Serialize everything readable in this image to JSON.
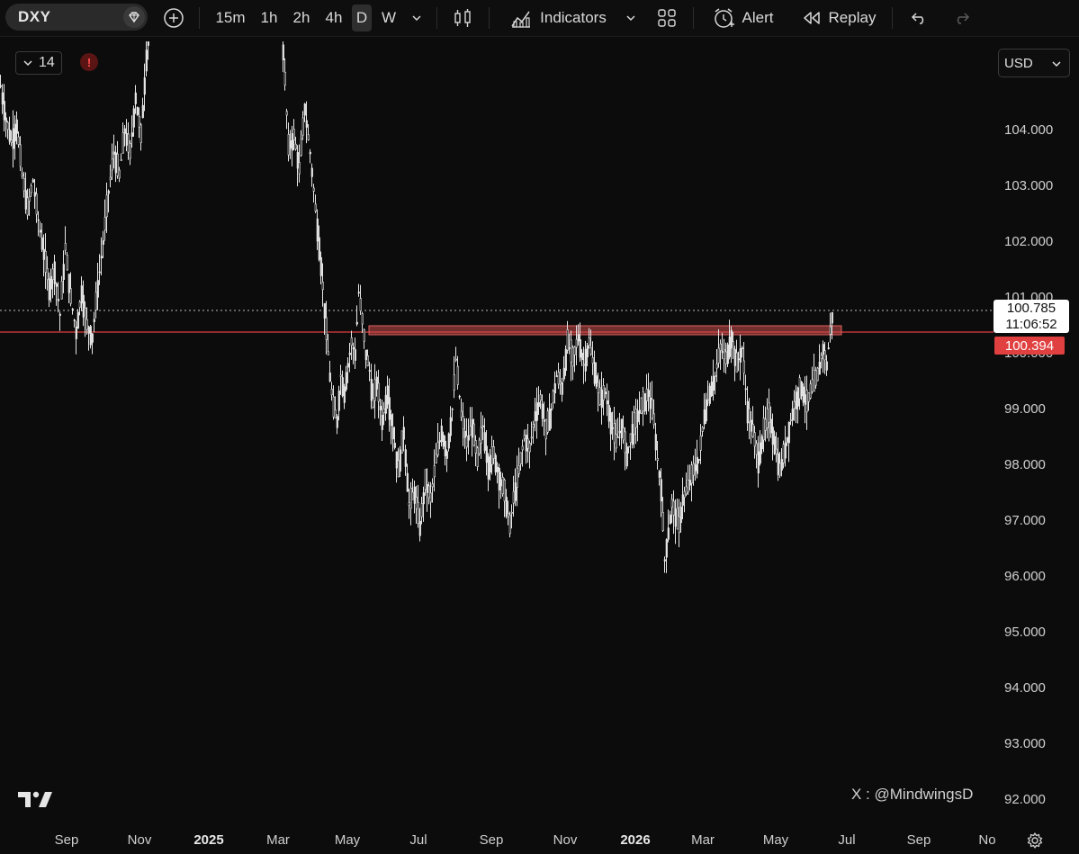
{
  "toolbar": {
    "symbol": "DXY",
    "timeframes": [
      "15m",
      "1h",
      "2h",
      "4h",
      "D",
      "W"
    ],
    "active_timeframe": "D",
    "indicators_label": "Indicators",
    "alert_label": "Alert",
    "replay_label": "Replay"
  },
  "legend": {
    "value": "14"
  },
  "currency": "USD",
  "price_axis": {
    "ticks": [
      "104.000",
      "103.000",
      "102.000",
      "101.000",
      "100.000",
      "99.000",
      "98.000",
      "97.000",
      "96.000",
      "95.000",
      "94.000",
      "93.000",
      "92.000"
    ]
  },
  "time_axis": {
    "ticks": [
      {
        "label": "Sep",
        "bold": false
      },
      {
        "label": "Nov",
        "bold": false
      },
      {
        "label": "2025",
        "bold": true
      },
      {
        "label": "Mar",
        "bold": false
      },
      {
        "label": "May",
        "bold": false
      },
      {
        "label": "Jul",
        "bold": false
      },
      {
        "label": "Sep",
        "bold": false
      },
      {
        "label": "Nov",
        "bold": false
      },
      {
        "label": "2026",
        "bold": true
      },
      {
        "label": "Mar",
        "bold": false
      },
      {
        "label": "May",
        "bold": false
      },
      {
        "label": "Jul",
        "bold": false
      },
      {
        "label": "Sep",
        "bold": false
      },
      {
        "label": "No",
        "bold": false
      }
    ]
  },
  "current_price": {
    "price": "100.785",
    "countdown": "11:06:52"
  },
  "level_price": "100.394",
  "watermark": "X : @MindwingsD",
  "colors": {
    "background": "#0c0c0c",
    "candle": "#e6e6e6",
    "level_line": "#e04040",
    "zone_fill": "#c84a4a"
  },
  "chart_data": {
    "type": "candlestick",
    "ylim": [
      91.5,
      105.0
    ],
    "horizontal_level": 100.394,
    "current_price": 100.785,
    "resistance_zone": [
      100.35,
      100.6
    ],
    "close_path": [
      [
        0,
        104.8
      ],
      [
        6,
        104.2
      ],
      [
        12,
        103.8
      ],
      [
        18,
        104.1
      ],
      [
        24,
        103.2
      ],
      [
        30,
        102.6
      ],
      [
        36,
        103.1
      ],
      [
        42,
        102.4
      ],
      [
        48,
        101.8
      ],
      [
        54,
        101.2
      ],
      [
        60,
        101.5
      ],
      [
        66,
        100.7
      ],
      [
        72,
        101.9
      ],
      [
        78,
        101.0
      ],
      [
        84,
        100.4
      ],
      [
        90,
        101.1
      ],
      [
        96,
        100.5
      ],
      [
        102,
        100.3
      ],
      [
        108,
        101.2
      ],
      [
        114,
        102.0
      ],
      [
        120,
        102.9
      ],
      [
        126,
        103.6
      ],
      [
        132,
        103.2
      ],
      [
        138,
        104.0
      ],
      [
        144,
        103.6
      ],
      [
        150,
        104.6
      ],
      [
        156,
        103.9
      ],
      [
        162,
        105.3
      ],
      [
        168,
        106.2
      ],
      [
        174,
        107.0
      ],
      [
        310,
        106.5
      ],
      [
        316,
        104.9
      ],
      [
        320,
        103.7
      ],
      [
        326,
        103.9
      ],
      [
        332,
        103.3
      ],
      [
        338,
        104.4
      ],
      [
        344,
        103.6
      ],
      [
        350,
        102.6
      ],
      [
        356,
        101.6
      ],
      [
        362,
        100.4
      ],
      [
        366,
        99.6
      ],
      [
        370,
        99.0
      ],
      [
        374,
        98.8
      ],
      [
        378,
        99.6
      ],
      [
        382,
        99.3
      ],
      [
        386,
        99.8
      ],
      [
        390,
        100.2
      ],
      [
        394,
        100.0
      ],
      [
        398,
        101.1
      ],
      [
        402,
        100.6
      ],
      [
        406,
        100.0
      ],
      [
        410,
        99.7
      ],
      [
        414,
        99.1
      ],
      [
        418,
        99.5
      ],
      [
        424,
        98.8
      ],
      [
        430,
        99.3
      ],
      [
        436,
        98.6
      ],
      [
        442,
        97.9
      ],
      [
        448,
        98.6
      ],
      [
        454,
        97.3
      ],
      [
        460,
        97.5
      ],
      [
        466,
        96.9
      ],
      [
        472,
        97.7
      ],
      [
        478,
        97.4
      ],
      [
        484,
        98.1
      ],
      [
        490,
        98.6
      ],
      [
        496,
        98.2
      ],
      [
        502,
        99.0
      ],
      [
        506,
        99.9
      ],
      [
        512,
        98.9
      ],
      [
        518,
        98.4
      ],
      [
        524,
        98.7
      ],
      [
        530,
        98.1
      ],
      [
        536,
        98.7
      ],
      [
        542,
        98.0
      ],
      [
        548,
        98.2
      ],
      [
        554,
        97.8
      ],
      [
        560,
        97.5
      ],
      [
        566,
        96.9
      ],
      [
        570,
        97.4
      ],
      [
        576,
        97.9
      ],
      [
        582,
        98.5
      ],
      [
        588,
        98.3
      ],
      [
        594,
        98.9
      ],
      [
        600,
        99.2
      ],
      [
        606,
        98.6
      ],
      [
        612,
        99.0
      ],
      [
        618,
        99.6
      ],
      [
        624,
        99.4
      ],
      [
        630,
        100.2
      ],
      [
        636,
        99.9
      ],
      [
        642,
        100.3
      ],
      [
        648,
        99.8
      ],
      [
        654,
        100.2
      ],
      [
        660,
        99.7
      ],
      [
        666,
        99.2
      ],
      [
        672,
        99.3
      ],
      [
        678,
        98.8
      ],
      [
        684,
        98.4
      ],
      [
        690,
        98.7
      ],
      [
        696,
        98.2
      ],
      [
        702,
        98.6
      ],
      [
        708,
        98.9
      ],
      [
        714,
        99.1
      ],
      [
        720,
        99.3
      ],
      [
        726,
        98.8
      ],
      [
        730,
        98.1
      ],
      [
        734,
        97.6
      ],
      [
        738,
        96.3
      ],
      [
        742,
        96.8
      ],
      [
        746,
        97.3
      ],
      [
        750,
        97.1
      ],
      [
        754,
        96.9
      ],
      [
        758,
        97.4
      ],
      [
        764,
        97.6
      ],
      [
        770,
        97.9
      ],
      [
        776,
        98.1
      ],
      [
        782,
        98.9
      ],
      [
        788,
        99.3
      ],
      [
        794,
        99.6
      ],
      [
        800,
        100.1
      ],
      [
        806,
        99.9
      ],
      [
        812,
        100.3
      ],
      [
        818,
        99.8
      ],
      [
        824,
        100.1
      ],
      [
        830,
        99.0
      ],
      [
        836,
        98.6
      ],
      [
        842,
        98.1
      ],
      [
        848,
        98.6
      ],
      [
        854,
        98.9
      ],
      [
        860,
        98.4
      ],
      [
        866,
        97.9
      ],
      [
        872,
        98.3
      ],
      [
        878,
        98.8
      ],
      [
        884,
        99.2
      ],
      [
        890,
        99.4
      ],
      [
        896,
        99.1
      ],
      [
        902,
        99.4
      ],
      [
        908,
        99.6
      ],
      [
        914,
        100.1
      ],
      [
        918,
        99.8
      ],
      [
        922,
        100.4
      ],
      [
        925,
        100.8
      ]
    ]
  }
}
